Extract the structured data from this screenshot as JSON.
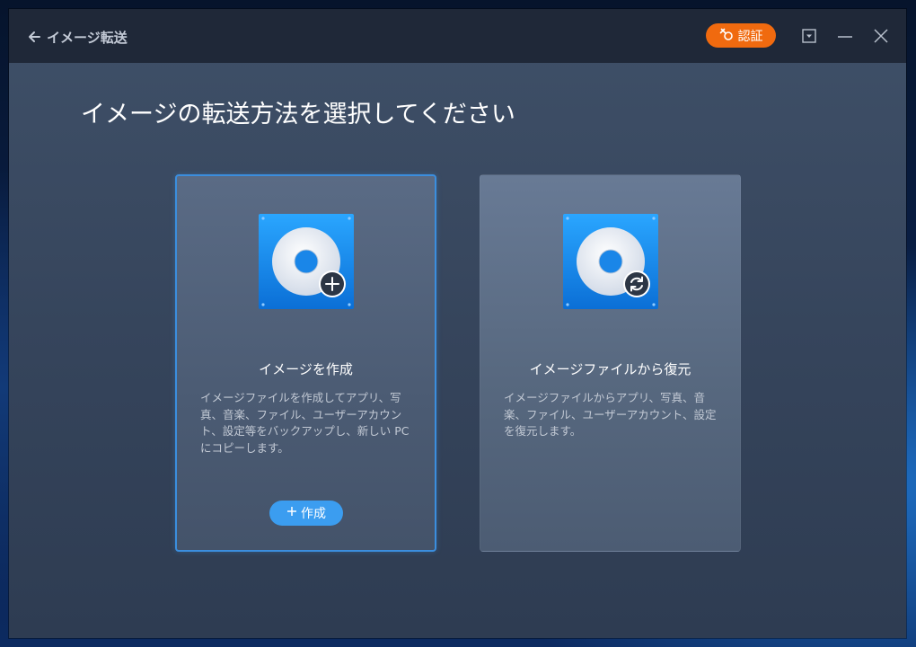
{
  "app": {
    "back_label": "イメージ転送",
    "auth_label": "認証",
    "accent_color": "#f06a0f"
  },
  "window_controls": [
    "dropdown-icon",
    "minimize-icon",
    "close-icon"
  ],
  "main": {
    "title": "イメージの転送方法を選択してください",
    "cards": [
      {
        "icon": "disc-plus-icon",
        "title": "イメージを作成",
        "description": "イメージファイルを作成してアプリ、写真、音楽、ファイル、ユーザーアカウント、設定等をバックアップし、新しい PC にコピーします。",
        "button_label": "作成",
        "selected": true
      },
      {
        "icon": "disc-restore-icon",
        "title": "イメージファイルから復元",
        "description": "イメージファイルからアプリ、写真、音楽、ファイル、ユーザーアカウント、設定を復元します。"
      }
    ]
  }
}
